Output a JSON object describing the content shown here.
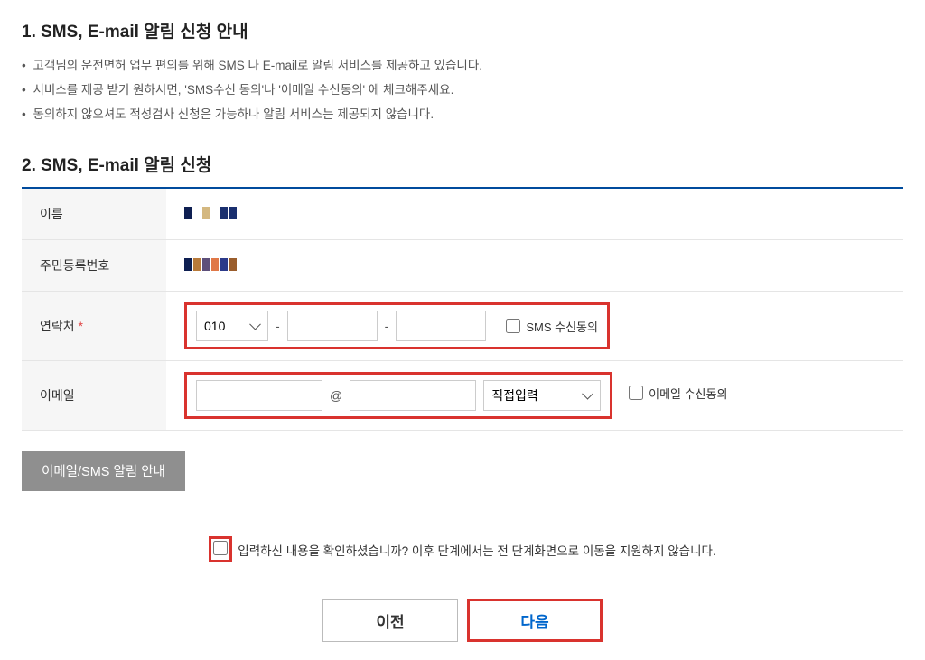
{
  "section1": {
    "title": "1. SMS, E-mail 알림 신청 안내",
    "bullets": [
      "고객님의 운전면허 업무 편의를 위해 SMS 나 E-mail로 알림 서비스를 제공하고 있습니다.",
      "서비스를 제공 받기 원하시면, 'SMS수신 동의'나 '이메일 수신동의' 에 체크해주세요.",
      "동의하지 않으셔도 적성검사 신청은 가능하나 알림 서비스는 제공되지 않습니다."
    ]
  },
  "section2": {
    "title": "2. SMS, E-mail 알림 신청",
    "rows": {
      "name_label": "이름",
      "rrn_label": "주민등록번호",
      "phone_label": "연락처",
      "phone_required": "*",
      "email_label": "이메일"
    },
    "phone": {
      "prefix": "010",
      "part1": "",
      "part2": "",
      "sms_consent_label": "SMS 수신동의"
    },
    "email": {
      "local": "",
      "at": "@",
      "domain": "",
      "domain_select": "직접입력",
      "email_consent_label": "이메일 수신동의"
    }
  },
  "info_button": "이메일/SMS 알림 안내",
  "confirm": "입력하신 내용을 확인하셨습니까? 이후 단계에서는 전 단계화면으로 이동을 지원하지 않습니다.",
  "nav": {
    "prev": "이전",
    "next": "다음"
  }
}
